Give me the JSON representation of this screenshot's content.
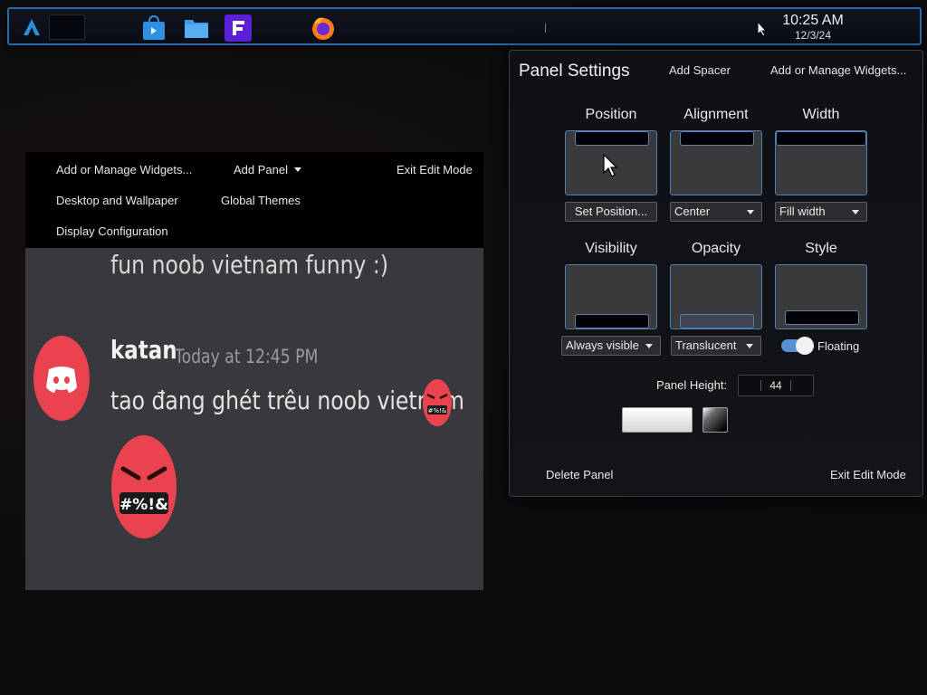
{
  "taskbar": {
    "icons": [
      {
        "name": "launcher-icon"
      },
      {
        "name": "discover-store-icon"
      },
      {
        "name": "file-manager-icon"
      },
      {
        "name": "f-app-icon"
      },
      {
        "name": "firefox-icon"
      }
    ],
    "clock_time": "10:25 AM",
    "clock_date": "12/3/24"
  },
  "desktop_toolbar": {
    "add_widgets": "Add or Manage Widgets...",
    "add_panel": "Add Panel",
    "exit_edit": "Exit Edit Mode",
    "desktop_wallpaper": "Desktop and Wallpaper",
    "global_themes": "Global Themes",
    "display_config": "Display Configuration"
  },
  "message": {
    "previous_line": "fun noob vietnam funny :)",
    "author": "katan",
    "timestamp": "Today at 12:45 PM",
    "body": "tao đang ghét trêu noob vietnam",
    "emoji_text": "#%!&",
    "emoji_text_small": "#%!&"
  },
  "panel_settings": {
    "title": "Panel Settings",
    "add_spacer": "Add Spacer",
    "add_widgets": "Add or Manage Widgets...",
    "position": {
      "label": "Position",
      "button": "Set Position..."
    },
    "alignment": {
      "label": "Alignment",
      "value": "Center"
    },
    "width": {
      "label": "Width",
      "value": "Fill width"
    },
    "visibility": {
      "label": "Visibility",
      "value": "Always visible"
    },
    "opacity": {
      "label": "Opacity",
      "value": "Translucent"
    },
    "style": {
      "label": "Style",
      "toggle_label": "Floating",
      "floating": true
    },
    "height_label": "Panel Height:",
    "height_value": "44",
    "delete_panel": "Delete Panel",
    "exit_edit": "Exit Edit Mode"
  },
  "colors": {
    "accent": "#4a7fb8",
    "toggle_on": "#5a8fd6",
    "panel_border": "#2a6aa8",
    "discord_red": "#e8434f"
  }
}
